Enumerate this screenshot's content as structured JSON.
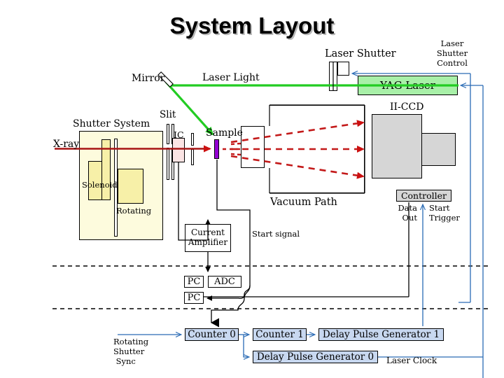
{
  "title": "System Layout",
  "labels": {
    "mirror": "Mirror",
    "laser_light": "Laser Light",
    "laser_shutter": "Laser Shutter",
    "laser_shutter_control": "Laser\nShutter\nControl",
    "yag_laser": "YAG Laser",
    "ii_ccd": "II-CCD",
    "shutter_system": "Shutter System",
    "slit": "Slit",
    "ic": "IC",
    "sample": "Sample",
    "xray": "X-ray",
    "solenoid": "Solenoid",
    "rotating": "Rotating",
    "vacuum_path": "Vacuum Path",
    "controller": "Controller",
    "data_out": "Data\nOut",
    "start_trigger": "Start\nTrigger",
    "current_amplifier": "Current\nAmplifier",
    "start_signal": "Start signal",
    "pc_top": "PC",
    "adc": "ADC",
    "pc_bottom": "PC",
    "counter0": "Counter 0",
    "counter1": "Counter 1",
    "delay_pulse_generator_1": "Delay Pulse Generator 1",
    "delay_pulse_generator_0": "Delay Pulse Generator 0",
    "laser_clock": "Laser Clock",
    "rotating_shutter_sync": "Rotating\nShutter\n Sync"
  },
  "colors": {
    "xray_beam": "#a81414",
    "laser_beam": "#22cc22",
    "diffraction": "#c31919",
    "control_line": "#2a6bb5",
    "sample_fill": "#9400d3",
    "shutter_fill": "#fdfbdd",
    "bar_fill": "#f7f0a8",
    "yag_fill": "#a8f0a8",
    "ccd_fill": "#d6d6d6",
    "logic_fill": "#c8d8f0",
    "ic_fill": "#fbe4e4",
    "wire": "#000000"
  }
}
